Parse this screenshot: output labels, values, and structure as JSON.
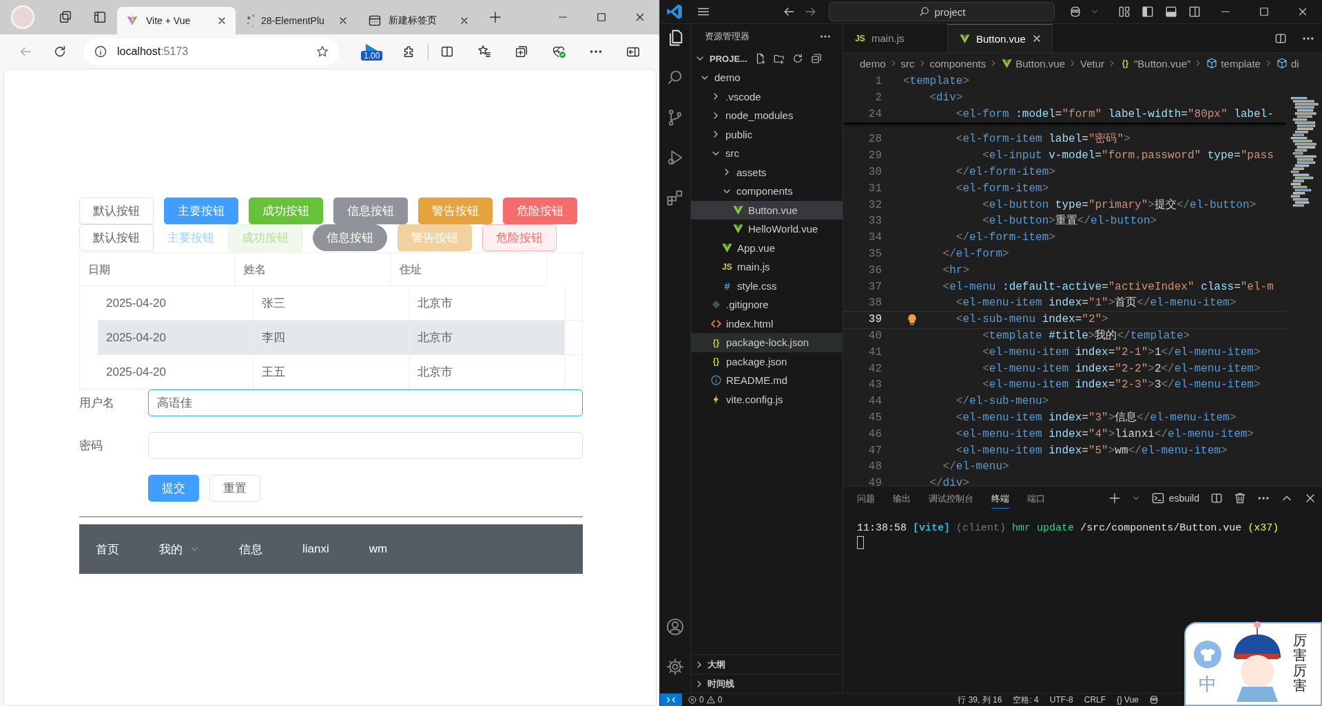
{
  "browser": {
    "tabs": [
      {
        "title": "Vite + Vue",
        "kind": "vite",
        "selected": true
      },
      {
        "title": "28-ElementPlu",
        "kind": "loading",
        "selected": false
      },
      {
        "title": "新建标签页",
        "kind": "newtab",
        "selected": false
      }
    ],
    "address": {
      "host": "localhost",
      "port": ":5173"
    },
    "extension_badge": "1.00",
    "page": {
      "button_rows": [
        [
          {
            "label": "默认按钮",
            "kind": "default",
            "plain": false,
            "round": false,
            "link": false,
            "disabled": false
          },
          {
            "label": "主要按钮",
            "kind": "primary",
            "plain": false,
            "round": false,
            "link": false,
            "disabled": false
          },
          {
            "label": "成功按钮",
            "kind": "success",
            "plain": false,
            "round": false,
            "link": false,
            "disabled": false
          },
          {
            "label": "信息按钮",
            "kind": "info",
            "plain": false,
            "round": false,
            "link": false,
            "disabled": false
          },
          {
            "label": "警告按钮",
            "kind": "warning",
            "plain": false,
            "round": false,
            "link": false,
            "disabled": false
          },
          {
            "label": "危险按钮",
            "kind": "danger",
            "plain": false,
            "round": false,
            "link": false,
            "disabled": false
          }
        ],
        [
          {
            "label": "默认按钮",
            "kind": "default",
            "plain": false,
            "round": false,
            "link": false,
            "disabled": false
          },
          {
            "label": "主要按钮",
            "kind": "primary",
            "plain": false,
            "round": false,
            "link": true,
            "disabled": true
          },
          {
            "label": "成功按钮",
            "kind": "success",
            "plain": true,
            "round": false,
            "link": false,
            "disabled": true
          },
          {
            "label": "信息按钮",
            "kind": "info",
            "plain": false,
            "round": true,
            "link": false,
            "disabled": false
          },
          {
            "label": "警告按钮",
            "kind": "warning",
            "plain": false,
            "round": false,
            "link": false,
            "disabled": true
          },
          {
            "label": "危险按钮",
            "kind": "danger",
            "plain": true,
            "round": false,
            "link": false,
            "disabled": false
          }
        ]
      ],
      "table": {
        "columns": [
          "日期",
          "姓名",
          "住址"
        ],
        "rows": [
          {
            "cells": [
              "2025-04-20",
              "张三",
              "北京市"
            ],
            "striped": false
          },
          {
            "cells": [
              "2025-04-20",
              "李四",
              "北京市"
            ],
            "striped": true
          },
          {
            "cells": [
              "2025-04-20",
              "王五",
              "北京市"
            ],
            "striped": false
          }
        ]
      },
      "form": {
        "fields": [
          {
            "label": "用户名",
            "value": "高语佳",
            "focused": true
          },
          {
            "label": "密码",
            "focused": false
          }
        ],
        "buttons": [
          {
            "label": "提交",
            "kind": "primary"
          },
          {
            "label": "重置",
            "kind": "default"
          }
        ]
      },
      "menu": [
        {
          "label": "首页",
          "has_submenu": false
        },
        {
          "label": "我的",
          "has_submenu": true
        },
        {
          "label": "信息",
          "has_submenu": false
        },
        {
          "label": "lianxi",
          "has_submenu": false
        },
        {
          "label": "wm",
          "has_submenu": false
        }
      ]
    }
  },
  "editor": {
    "search": "project",
    "explorer": {
      "title": "资源管理器",
      "project": "PROJE...",
      "tree": [
        {
          "label": "demo",
          "kind": "folder",
          "expanded": true,
          "selected": false,
          "hovered": false,
          "children": [
            {
              "label": ".vscode",
              "kind": "folder",
              "expanded": false,
              "selected": false,
              "hovered": false
            },
            {
              "label": "node_modules",
              "kind": "folder",
              "expanded": false,
              "selected": false,
              "hovered": false
            },
            {
              "label": "public",
              "kind": "folder",
              "expanded": false,
              "selected": false,
              "hovered": false
            },
            {
              "label": "src",
              "kind": "folder",
              "expanded": true,
              "selected": false,
              "hovered": false,
              "children": [
                {
                  "label": "assets",
                  "kind": "folder",
                  "expanded": false,
                  "selected": false,
                  "hovered": false
                },
                {
                  "label": "components",
                  "kind": "folder",
                  "expanded": true,
                  "selected": false,
                  "hovered": false,
                  "children": [
                    {
                      "label": "Button.vue",
                      "kind": "vue",
                      "selected": true,
                      "hovered": false
                    },
                    {
                      "label": "HelloWorld.vue",
                      "kind": "vue",
                      "selected": false,
                      "hovered": false
                    }
                  ]
                },
                {
                  "label": "App.vue",
                  "kind": "vue",
                  "selected": false,
                  "hovered": false
                },
                {
                  "label": "main.js",
                  "kind": "js",
                  "icon_text": "JS",
                  "selected": false,
                  "hovered": false
                },
                {
                  "label": "style.css",
                  "kind": "css",
                  "icon_text": "#",
                  "selected": false,
                  "hovered": false
                }
              ]
            },
            {
              "label": ".gitignore",
              "kind": "git",
              "selected": false,
              "hovered": false
            },
            {
              "label": "index.html",
              "kind": "html",
              "selected": false,
              "hovered": false
            },
            {
              "label": "package-lock.json",
              "kind": "json",
              "icon_text": "{}",
              "selected": false,
              "hovered": true
            },
            {
              "label": "package.json",
              "kind": "json",
              "icon_text": "{}",
              "selected": false,
              "hovered": false
            },
            {
              "label": "README.md",
              "kind": "info",
              "selected": false,
              "hovered": false
            },
            {
              "label": "vite.config.js",
              "kind": "bolt",
              "selected": false,
              "hovered": false
            }
          ]
        }
      ],
      "sections": [
        {
          "label": "大纲",
          "expanded": false
        },
        {
          "label": "时间线",
          "expanded": false
        }
      ]
    },
    "tabs": [
      {
        "label": "main.js",
        "kind": "js",
        "icon_text": "JS",
        "selected": false
      },
      {
        "label": "Button.vue",
        "kind": "vue",
        "selected": true
      }
    ],
    "breadcrumb": [
      {
        "label": "demo",
        "kind": "plain"
      },
      {
        "label": "src",
        "kind": "plain"
      },
      {
        "label": "components",
        "kind": "plain"
      },
      {
        "label": "Button.vue",
        "kind": "vue"
      },
      {
        "label": "Vetur",
        "kind": "plain"
      },
      {
        "label": "\"Button.vue\"",
        "kind": "object",
        "icon_text": "{}"
      },
      {
        "label": "template",
        "kind": "element"
      },
      {
        "label": "di",
        "kind": "element"
      }
    ],
    "sticky_lines": [
      {
        "number": "1",
        "text": "<template>",
        "current": false
      },
      {
        "number": "2",
        "text": "    <div>",
        "current": false
      },
      {
        "number": "24",
        "text": "        <el-form :model=\"form\" label-width=\"80px\" label-",
        "current": false
      }
    ],
    "lines": [
      {
        "number": "28",
        "text": "        <el-form-item label=\"密码\">",
        "current": false
      },
      {
        "number": "29",
        "text": "            <el-input v-model=\"form.password\" type=\"pass",
        "current": false
      },
      {
        "number": "30",
        "text": "        </el-form-item>",
        "current": false
      },
      {
        "number": "31",
        "text": "        <el-form-item>",
        "current": false
      },
      {
        "number": "32",
        "text": "            <el-button type=\"primary\">提交</el-button>",
        "current": false
      },
      {
        "number": "33",
        "text": "            <el-button>重置</el-button>",
        "current": false
      },
      {
        "number": "34",
        "text": "        </el-form-item>",
        "current": false
      },
      {
        "number": "35",
        "text": "      </el-form>",
        "current": false
      },
      {
        "number": "36",
        "text": "      <hr>",
        "current": false
      },
      {
        "number": "37",
        "text": "      <el-menu :default-active=\"activeIndex\" class=\"el-m",
        "current": false
      },
      {
        "number": "38",
        "text": "        <el-menu-item index=\"1\">首页</el-menu-item>",
        "current": false
      },
      {
        "number": "39",
        "text": "        <el-sub-menu index=\"2\">",
        "current": true
      },
      {
        "number": "40",
        "text": "            <template #title>我的</template>",
        "current": false
      },
      {
        "number": "41",
        "text": "            <el-menu-item index=\"2-1\">1</el-menu-item>",
        "current": false
      },
      {
        "number": "42",
        "text": "            <el-menu-item index=\"2-2\">2</el-menu-item>",
        "current": false
      },
      {
        "number": "43",
        "text": "            <el-menu-item index=\"2-3\">3</el-menu-item>",
        "current": false
      },
      {
        "number": "44",
        "text": "        </el-sub-menu>",
        "current": false
      },
      {
        "number": "45",
        "text": "        <el-menu-item index=\"3\">信息</el-menu-item>",
        "current": false
      },
      {
        "number": "46",
        "text": "        <el-menu-item index=\"4\">lianxi</el-menu-item>",
        "current": false
      },
      {
        "number": "47",
        "text": "        <el-menu-item index=\"5\">wm</el-menu-item>",
        "current": false
      },
      {
        "number": "48",
        "text": "      </el-menu>",
        "current": false
      },
      {
        "number": "49",
        "text": "    </div>",
        "current": false
      }
    ],
    "panel": {
      "tabs": [
        {
          "label": "问题",
          "selected": false
        },
        {
          "label": "输出",
          "selected": false
        },
        {
          "label": "调试控制台",
          "selected": false
        },
        {
          "label": "终端",
          "selected": true
        },
        {
          "label": "端口",
          "selected": false
        }
      ],
      "terminal_name": "esbuild",
      "output": [
        {
          "text": "11:38:58",
          "kind": "time"
        },
        {
          "text": "[vite]",
          "kind": "tag"
        },
        {
          "text": "(client)",
          "kind": "dim"
        },
        {
          "text": "hmr update",
          "kind": "action"
        },
        {
          "text": "/src/components/Button.vue",
          "kind": "path"
        },
        {
          "text": "(x37)",
          "kind": "count"
        }
      ]
    },
    "status": {
      "errors": "0",
      "warnings": "0",
      "items": [
        {
          "text": "行 39, 列 16"
        },
        {
          "text": "空格: 4"
        },
        {
          "text": "UTF-8"
        },
        {
          "text": "CRLF"
        },
        {
          "text": "Vue",
          "icon_text": "{}"
        }
      ]
    }
  },
  "ime_widget": {
    "mode": "中",
    "caption": "厉害厉害"
  }
}
